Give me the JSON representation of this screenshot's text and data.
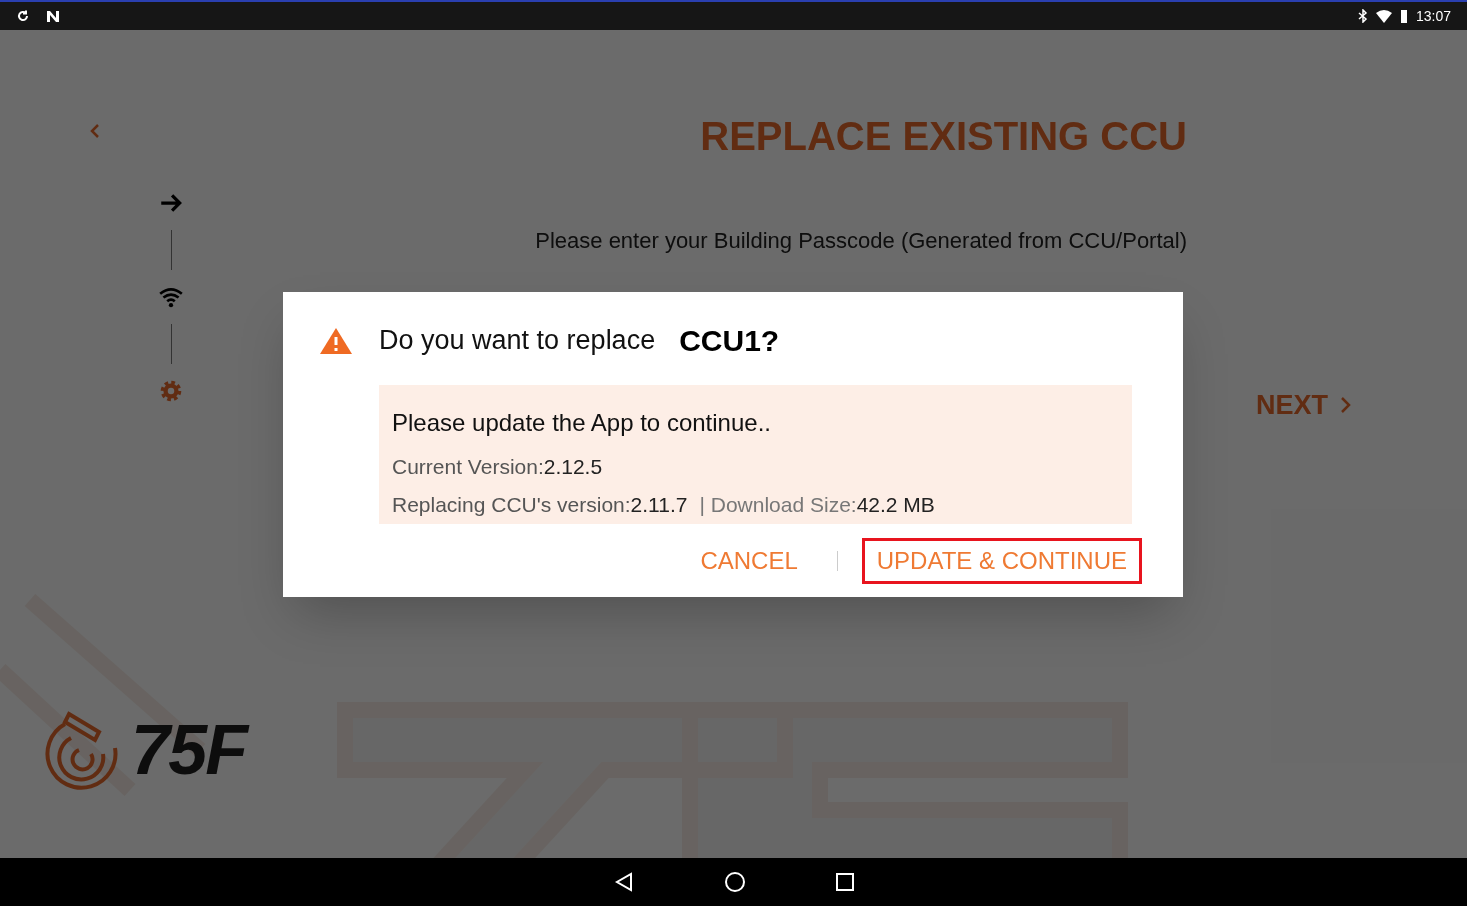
{
  "status_bar": {
    "time": "13:07"
  },
  "page": {
    "title": "REPLACE EXISTING CCU",
    "instruction": "Please enter your Building Passcode (Generated from CCU/Portal)",
    "next_label": "NEXT",
    "logo_text": "75F"
  },
  "steps": [
    {
      "kind": "arrow",
      "active": false
    },
    {
      "kind": "wifi",
      "active": false
    },
    {
      "kind": "gear",
      "active": true
    }
  ],
  "dialog": {
    "question": "Do you want to replace",
    "device": "CCU1?",
    "message": "Please update the App to continue..",
    "details": [
      {
        "text": "Current Version:**2.12.5**"
      },
      {
        "text": "Replacing CCU's version:**2.11.7**",
        "note": "| Download Size:**42.2 MB**"
      }
    ],
    "buttons": [
      {
        "label": "CANCEL",
        "highlighted": false
      },
      {
        "label": "UPDATE & CONTINUE",
        "highlighted": true
      }
    ]
  }
}
